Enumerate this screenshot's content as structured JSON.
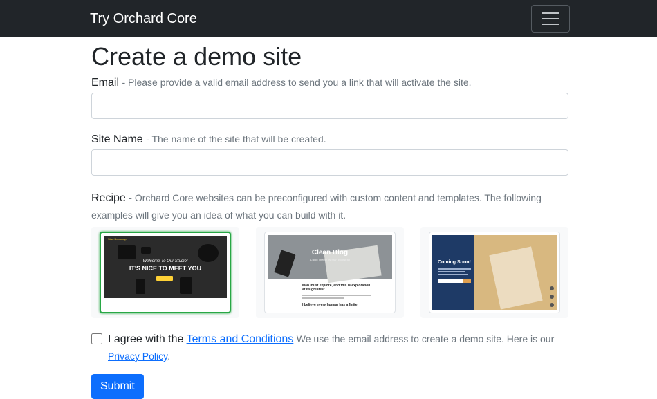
{
  "navbar": {
    "brand": "Try Orchard Core",
    "toggle_icon": "hamburger-menu-icon"
  },
  "page": {
    "title": "Create a demo site"
  },
  "form": {
    "email": {
      "label": "Email",
      "hint": "- Please provide a valid email address to send you a link that will activate the site.",
      "value": "",
      "placeholder": ""
    },
    "site_name": {
      "label": "Site Name",
      "hint": "- The name of the site that will be created.",
      "value": "",
      "placeholder": ""
    },
    "recipe": {
      "label": "Recipe",
      "hint": "- Orchard Core websites can be preconfigured with custom content and templates. The following examples will give you an idea of what you can build with it.",
      "options": [
        {
          "id": "agency",
          "selected": true,
          "preview": {
            "nav_brand": "Start Bootstrap",
            "tagline": "Welcome To Our Studio!",
            "headline": "IT'S NICE TO MEET YOU"
          }
        },
        {
          "id": "blog",
          "selected": false,
          "preview": {
            "title": "Clean Blog",
            "subtitle": "A Blog Theme by Start Bootstrap",
            "post1": "Man must explore, and this is exploration at its greatest",
            "post2": "I believe every human has a finite"
          }
        },
        {
          "id": "coming-soon",
          "selected": false,
          "preview": {
            "title": "Coming Soon!"
          }
        }
      ]
    },
    "agree": {
      "checked": false,
      "prefix": "I agree with the",
      "terms_link": "Terms and Conditions",
      "note": "We use the email address to create a demo site. Here is our",
      "privacy_link": "Privacy Policy",
      "suffix": "."
    },
    "submit_label": "Submit"
  },
  "colors": {
    "navbar_bg": "#212529",
    "primary": "#0d6efd",
    "selected_border": "#28a745"
  }
}
